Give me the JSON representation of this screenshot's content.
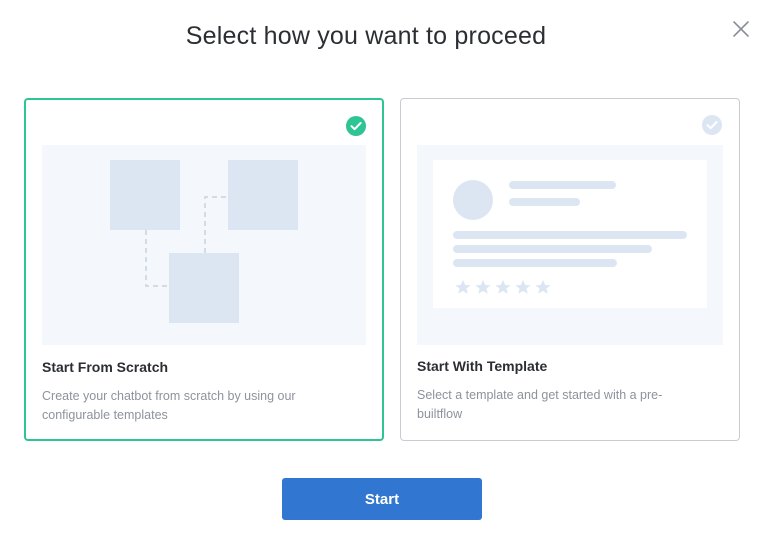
{
  "dialog": {
    "title": "Select how you want to proceed",
    "close_icon": "close-icon"
  },
  "options": [
    {
      "title": "Start From Scratch",
      "description": "Create your chatbot from scratch by using our configurable templates",
      "selected": true,
      "check_icon": "check-circle-icon"
    },
    {
      "title": "Start With Template",
      "description": "Select a template and get started with a pre-builtflow",
      "selected": false,
      "check_icon": "check-circle-icon"
    }
  ],
  "start_button": {
    "label": "Start"
  },
  "colors": {
    "selected_border": "#2ec493",
    "unselected_border": "#c8ccd2",
    "primary_button": "#3176d0",
    "illustration_bg": "#f4f8fc",
    "illustration_shape": "#dce6f2"
  }
}
